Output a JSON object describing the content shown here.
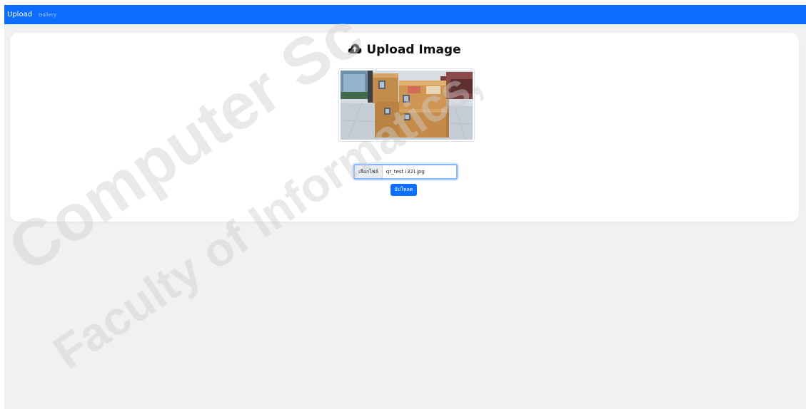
{
  "navbar": {
    "brand_label": "Upload",
    "gallery_label": "Gallery"
  },
  "card": {
    "title": "Upload Image",
    "title_icon": "cloud-upload-icon"
  },
  "file_input": {
    "button_label": "เลือกไฟล์",
    "file_name": "qr_test (32).jpg"
  },
  "upload_button": {
    "label": "อัปโหลด"
  },
  "watermark": {
    "line1": "Computer Sc",
    "line2": "Faculty of Informatics,"
  },
  "colors": {
    "navbar": "#0d6efd",
    "primary_button": "#0d6efd",
    "page_background": "#f1f1f1",
    "card_background": "#ffffff"
  }
}
